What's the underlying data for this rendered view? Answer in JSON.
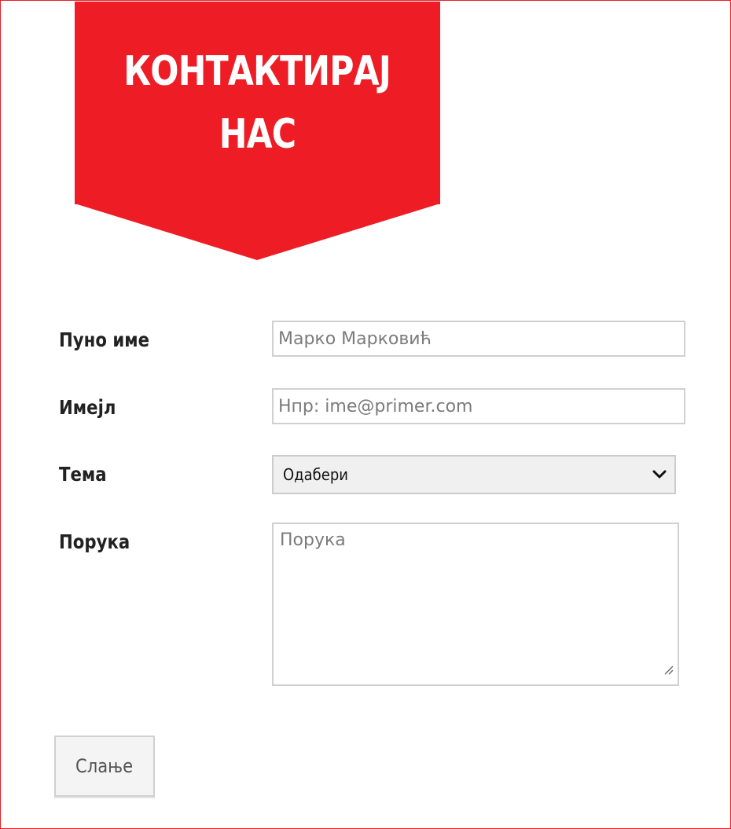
{
  "header": {
    "title_line1": "КОНТАКТИРАЈ",
    "title_line2": "НАС"
  },
  "form": {
    "name": {
      "label": "Пуно име",
      "placeholder": "Марко Марковић"
    },
    "email": {
      "label": "Имејл",
      "placeholder": "Нпр: ime@primer.com"
    },
    "topic": {
      "label": "Тема",
      "selected": "Одабери"
    },
    "message": {
      "label": "Порука",
      "placeholder": "Порука"
    },
    "submit_label": "Слање"
  },
  "colors": {
    "accent": "#ee1c25",
    "border": "#e8202a",
    "input_border": "#d0d0d0",
    "label_text": "#222222"
  },
  "icons": {
    "select": "chevron-down-icon",
    "textarea": "resize-handle-icon"
  }
}
